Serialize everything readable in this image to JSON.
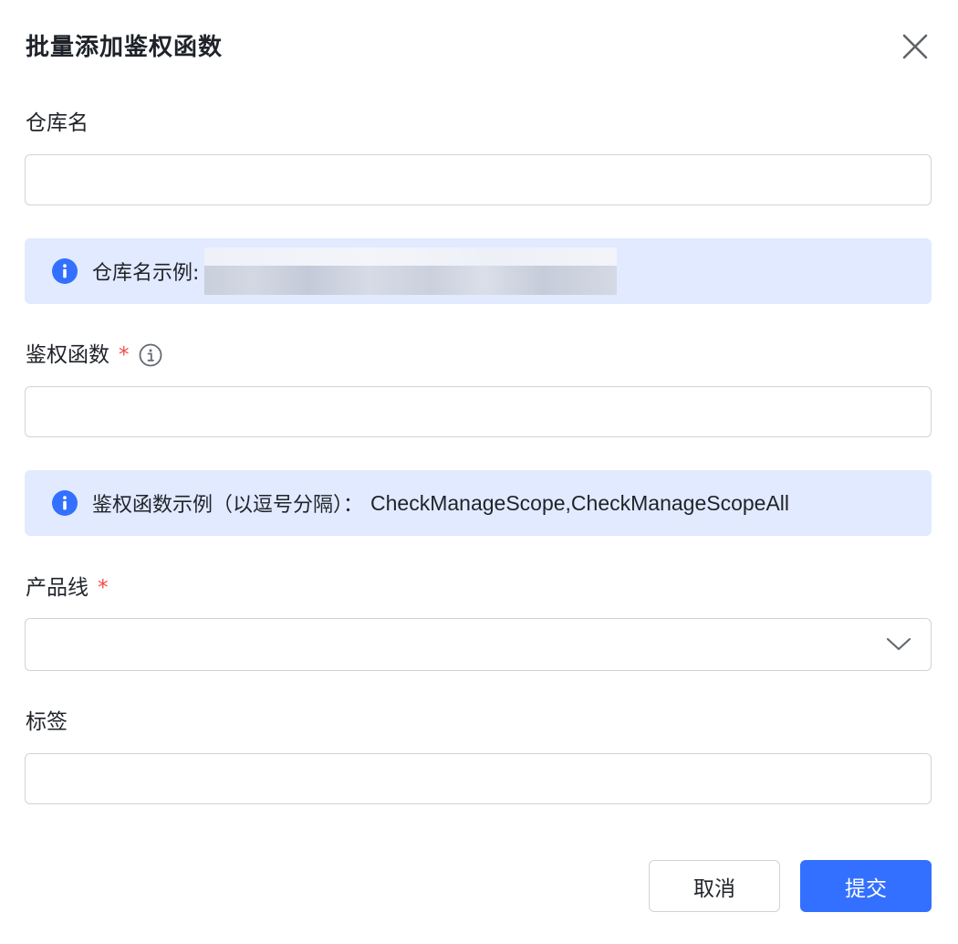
{
  "dialog": {
    "title": "批量添加鉴权函数",
    "close_icon": "close-icon"
  },
  "fields": {
    "repo_name": {
      "label": "仓库名",
      "value": "",
      "placeholder": "",
      "hint_icon": "info-filled-icon",
      "hint_text": "仓库名示例:"
    },
    "auth_func": {
      "label": "鉴权函数",
      "required_mark": "*",
      "label_icon": "info-outline-icon",
      "value": "",
      "placeholder": "",
      "hint_icon": "info-filled-icon",
      "hint_text": "鉴权函数示例（以逗号分隔）：",
      "hint_example": "CheckManageScope,CheckManageScopeAll"
    },
    "product_line": {
      "label": "产品线",
      "required_mark": "*",
      "selected": "",
      "arrow_icon": "chevron-down-icon"
    },
    "tags": {
      "label": "标签",
      "value": "",
      "placeholder": ""
    }
  },
  "footer": {
    "cancel_label": "取消",
    "submit_label": "提交"
  },
  "colors": {
    "primary": "#3370ff",
    "alert_bg": "#e1eaff",
    "required": "#f54a45",
    "border": "#d0d3d6",
    "text": "#1f2329"
  }
}
